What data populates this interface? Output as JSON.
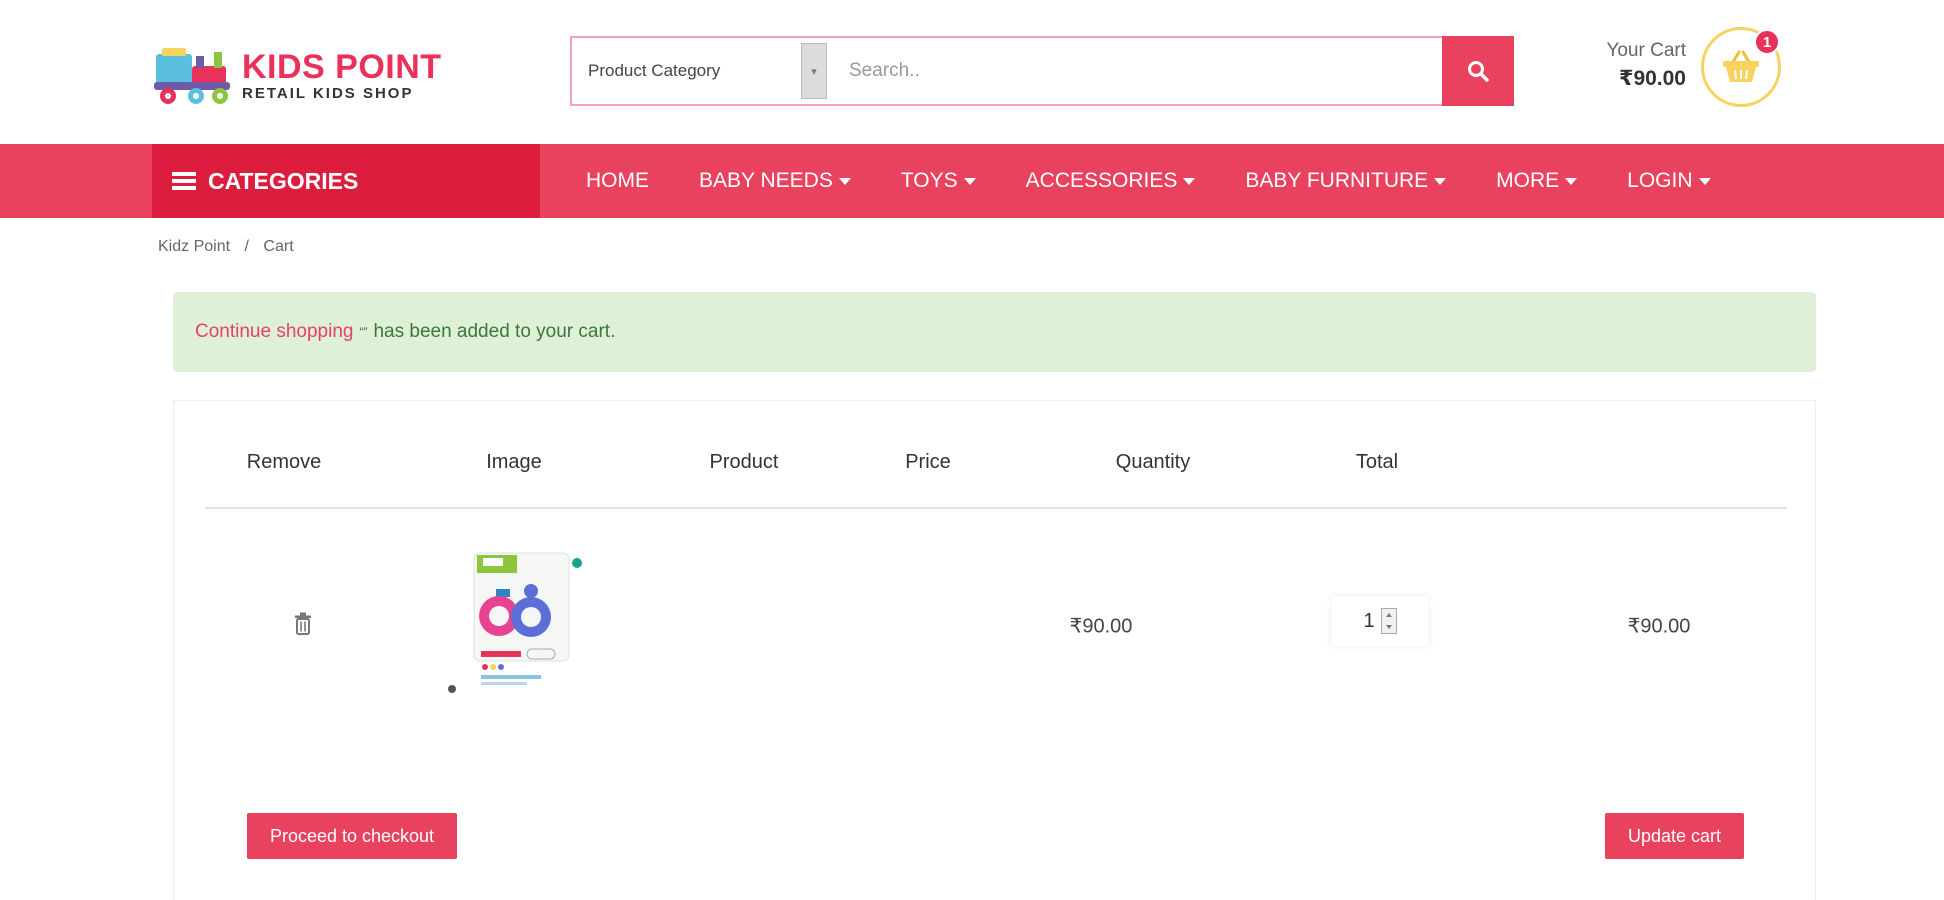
{
  "header": {
    "logo_title": "KIDS POINT",
    "logo_subtitle": "RETAIL  KIDS SHOP",
    "search": {
      "category_label": "Product Category",
      "placeholder": "Search..",
      "value": ""
    },
    "cart": {
      "label": "Your Cart",
      "amount": "₹90.00",
      "badge_count": "1"
    }
  },
  "nav": {
    "categories_label": "CATEGORIES",
    "items": [
      {
        "label": "HOME",
        "dropdown": false
      },
      {
        "label": "BABY NEEDS",
        "dropdown": true
      },
      {
        "label": "TOYS",
        "dropdown": true
      },
      {
        "label": "ACCESSORIES",
        "dropdown": true
      },
      {
        "label": "BABY FURNITURE",
        "dropdown": true
      },
      {
        "label": "MORE",
        "dropdown": true
      },
      {
        "label": "LOGIN",
        "dropdown": true
      }
    ]
  },
  "breadcrumb": {
    "home": "Kidz Point",
    "separator": "/",
    "current": "Cart"
  },
  "notice": {
    "link": "Continue shopping",
    "quote": "“”",
    "message": "has been added to your cart."
  },
  "cart_table": {
    "headers": {
      "remove": "Remove",
      "image": "Image",
      "product": "Product",
      "price": "Price",
      "quantity": "Quantity",
      "total": "Total"
    },
    "rows": [
      {
        "product": "",
        "price": "₹90.00",
        "quantity": "1",
        "total": "₹90.00"
      }
    ],
    "checkout_label": "Proceed to checkout",
    "update_label": "Update cart"
  },
  "colors": {
    "brand": "#e8425f",
    "brand_dark": "#dc1d3e",
    "notice_bg": "#dff0d8",
    "basket_ring": "#f5d35e"
  },
  "icons": {
    "search": "search-icon",
    "basket": "basket-icon",
    "menu": "hamburger-icon",
    "remove": "trash-icon"
  }
}
